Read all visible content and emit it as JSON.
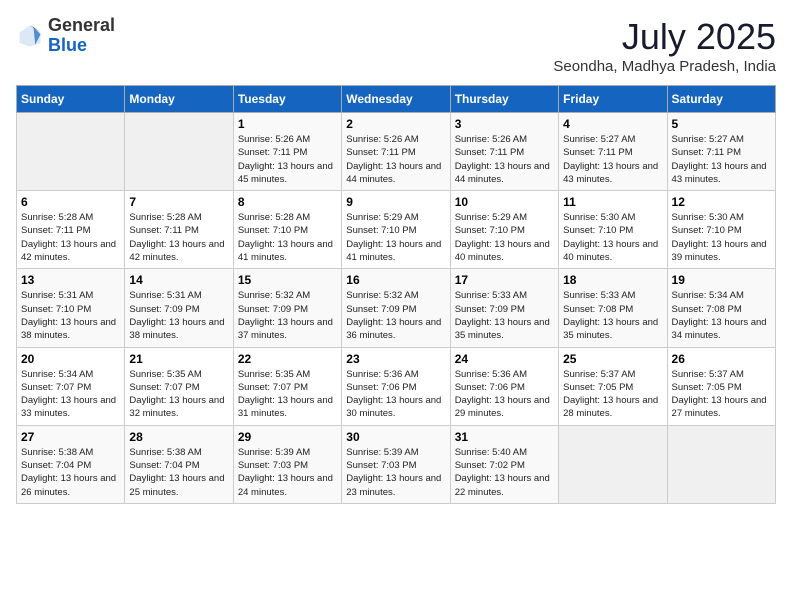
{
  "header": {
    "logo_line1": "General",
    "logo_line2": "Blue",
    "month": "July 2025",
    "location": "Seondha, Madhya Pradesh, India"
  },
  "days_of_week": [
    "Sunday",
    "Monday",
    "Tuesday",
    "Wednesday",
    "Thursday",
    "Friday",
    "Saturday"
  ],
  "weeks": [
    [
      {
        "day": "",
        "info": ""
      },
      {
        "day": "",
        "info": ""
      },
      {
        "day": "1",
        "info": "Sunrise: 5:26 AM\nSunset: 7:11 PM\nDaylight: 13 hours and 45 minutes."
      },
      {
        "day": "2",
        "info": "Sunrise: 5:26 AM\nSunset: 7:11 PM\nDaylight: 13 hours and 44 minutes."
      },
      {
        "day": "3",
        "info": "Sunrise: 5:26 AM\nSunset: 7:11 PM\nDaylight: 13 hours and 44 minutes."
      },
      {
        "day": "4",
        "info": "Sunrise: 5:27 AM\nSunset: 7:11 PM\nDaylight: 13 hours and 43 minutes."
      },
      {
        "day": "5",
        "info": "Sunrise: 5:27 AM\nSunset: 7:11 PM\nDaylight: 13 hours and 43 minutes."
      }
    ],
    [
      {
        "day": "6",
        "info": "Sunrise: 5:28 AM\nSunset: 7:11 PM\nDaylight: 13 hours and 42 minutes."
      },
      {
        "day": "7",
        "info": "Sunrise: 5:28 AM\nSunset: 7:11 PM\nDaylight: 13 hours and 42 minutes."
      },
      {
        "day": "8",
        "info": "Sunrise: 5:28 AM\nSunset: 7:10 PM\nDaylight: 13 hours and 41 minutes."
      },
      {
        "day": "9",
        "info": "Sunrise: 5:29 AM\nSunset: 7:10 PM\nDaylight: 13 hours and 41 minutes."
      },
      {
        "day": "10",
        "info": "Sunrise: 5:29 AM\nSunset: 7:10 PM\nDaylight: 13 hours and 40 minutes."
      },
      {
        "day": "11",
        "info": "Sunrise: 5:30 AM\nSunset: 7:10 PM\nDaylight: 13 hours and 40 minutes."
      },
      {
        "day": "12",
        "info": "Sunrise: 5:30 AM\nSunset: 7:10 PM\nDaylight: 13 hours and 39 minutes."
      }
    ],
    [
      {
        "day": "13",
        "info": "Sunrise: 5:31 AM\nSunset: 7:10 PM\nDaylight: 13 hours and 38 minutes."
      },
      {
        "day": "14",
        "info": "Sunrise: 5:31 AM\nSunset: 7:09 PM\nDaylight: 13 hours and 38 minutes."
      },
      {
        "day": "15",
        "info": "Sunrise: 5:32 AM\nSunset: 7:09 PM\nDaylight: 13 hours and 37 minutes."
      },
      {
        "day": "16",
        "info": "Sunrise: 5:32 AM\nSunset: 7:09 PM\nDaylight: 13 hours and 36 minutes."
      },
      {
        "day": "17",
        "info": "Sunrise: 5:33 AM\nSunset: 7:09 PM\nDaylight: 13 hours and 35 minutes."
      },
      {
        "day": "18",
        "info": "Sunrise: 5:33 AM\nSunset: 7:08 PM\nDaylight: 13 hours and 35 minutes."
      },
      {
        "day": "19",
        "info": "Sunrise: 5:34 AM\nSunset: 7:08 PM\nDaylight: 13 hours and 34 minutes."
      }
    ],
    [
      {
        "day": "20",
        "info": "Sunrise: 5:34 AM\nSunset: 7:07 PM\nDaylight: 13 hours and 33 minutes."
      },
      {
        "day": "21",
        "info": "Sunrise: 5:35 AM\nSunset: 7:07 PM\nDaylight: 13 hours and 32 minutes."
      },
      {
        "day": "22",
        "info": "Sunrise: 5:35 AM\nSunset: 7:07 PM\nDaylight: 13 hours and 31 minutes."
      },
      {
        "day": "23",
        "info": "Sunrise: 5:36 AM\nSunset: 7:06 PM\nDaylight: 13 hours and 30 minutes."
      },
      {
        "day": "24",
        "info": "Sunrise: 5:36 AM\nSunset: 7:06 PM\nDaylight: 13 hours and 29 minutes."
      },
      {
        "day": "25",
        "info": "Sunrise: 5:37 AM\nSunset: 7:05 PM\nDaylight: 13 hours and 28 minutes."
      },
      {
        "day": "26",
        "info": "Sunrise: 5:37 AM\nSunset: 7:05 PM\nDaylight: 13 hours and 27 minutes."
      }
    ],
    [
      {
        "day": "27",
        "info": "Sunrise: 5:38 AM\nSunset: 7:04 PM\nDaylight: 13 hours and 26 minutes."
      },
      {
        "day": "28",
        "info": "Sunrise: 5:38 AM\nSunset: 7:04 PM\nDaylight: 13 hours and 25 minutes."
      },
      {
        "day": "29",
        "info": "Sunrise: 5:39 AM\nSunset: 7:03 PM\nDaylight: 13 hours and 24 minutes."
      },
      {
        "day": "30",
        "info": "Sunrise: 5:39 AM\nSunset: 7:03 PM\nDaylight: 13 hours and 23 minutes."
      },
      {
        "day": "31",
        "info": "Sunrise: 5:40 AM\nSunset: 7:02 PM\nDaylight: 13 hours and 22 minutes."
      },
      {
        "day": "",
        "info": ""
      },
      {
        "day": "",
        "info": ""
      }
    ]
  ]
}
